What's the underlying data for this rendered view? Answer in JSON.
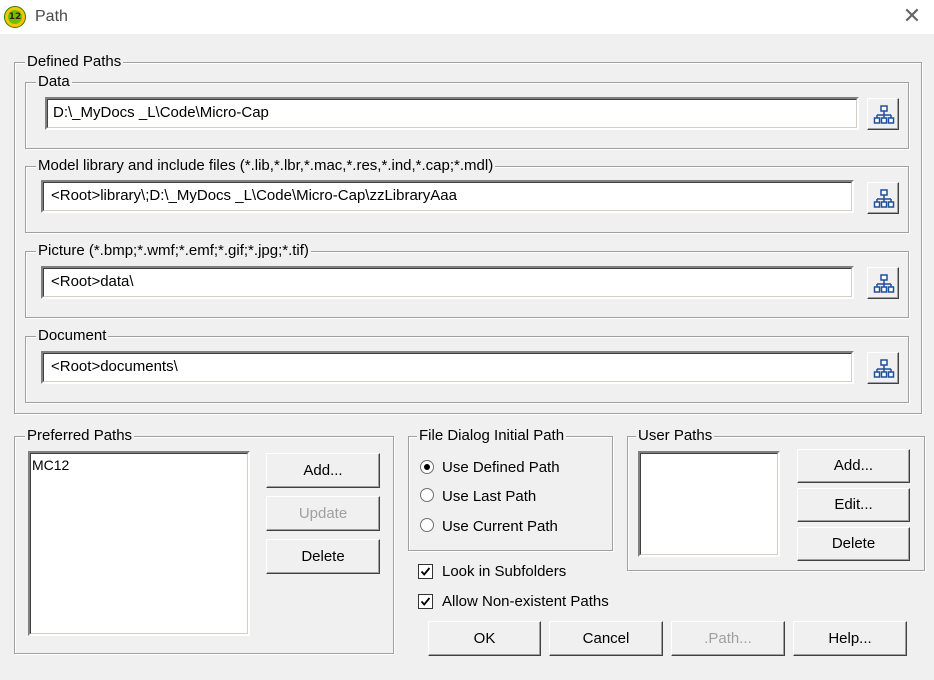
{
  "window": {
    "title": "Path",
    "app_icon_text": "12",
    "close_glyph": "✕"
  },
  "defined_paths": {
    "label": "Defined Paths",
    "data": {
      "label": "Data",
      "value": "D:\\_MyDocs _L\\Code\\Micro-Cap"
    },
    "model": {
      "label": "Model library and include files (*.lib,*.lbr,*.mac,*.res,*.ind,*.cap;*.mdl)",
      "value": "<Root>library\\;D:\\_MyDocs _L\\Code\\Micro-Cap\\zzLibraryAaa"
    },
    "picture": {
      "label": "Picture (*.bmp;*.wmf;*.emf;*.gif;*.jpg;*.tif)",
      "value": "<Root>data\\"
    },
    "document": {
      "label": "Document",
      "value": "<Root>documents\\"
    }
  },
  "preferred_paths": {
    "label": "Preferred Paths",
    "items": [
      "MC12"
    ],
    "add_label": "Add...",
    "update_label": "Update",
    "delete_label": "Delete"
  },
  "file_dialog": {
    "label": "File Dialog Initial Path",
    "options": [
      "Use Defined Path",
      "Use Last Path",
      "Use Current Path"
    ],
    "selected": "Use Defined Path"
  },
  "user_paths": {
    "label": "User Paths",
    "add_label": "Add...",
    "edit_label": "Edit...",
    "delete_label": "Delete"
  },
  "options": {
    "look_in_subfolders": {
      "label": "Look in Subfolders",
      "checked": true
    },
    "allow_nonexistent": {
      "label": "Allow Non-existent Paths",
      "checked": true
    }
  },
  "buttons": {
    "ok": "OK",
    "cancel": "Cancel",
    "path": ".Path...",
    "help": "Help..."
  },
  "icons": {
    "browse": "tree-browse-icon",
    "check": "checkmark-icon"
  },
  "colors": {
    "dialog_bg": "#f0f0f0",
    "disabled_text": "#a0a0a0",
    "icon_blue": "#1f4e9a"
  }
}
